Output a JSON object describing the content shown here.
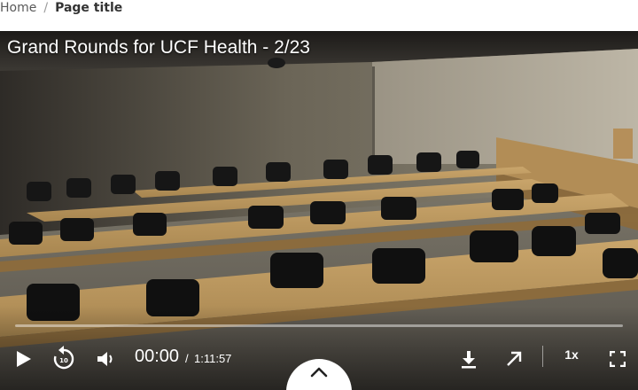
{
  "breadcrumb": {
    "home_label": "Home",
    "separator": "/",
    "current_label": "Page title"
  },
  "player": {
    "title": "Grand Rounds for UCF Health - 2/23",
    "current_time": "00:00",
    "time_separator": "/",
    "duration": "1:11:57",
    "progress": 0,
    "playback_speed": "1x",
    "controls": {
      "play": "play-icon",
      "rewind": "rewind-10-icon",
      "rewind_seconds": "10",
      "volume": "volume-icon",
      "download": "download-icon",
      "popout": "arrow-up-right-icon",
      "fullscreen": "fullscreen-icon",
      "expand": "chevron-up-icon"
    }
  },
  "colors": {
    "control_text": "#ffffff",
    "breadcrumb_link": "#5a5a5a",
    "breadcrumb_current": "#333333",
    "expand_tab": "#ffffff"
  }
}
